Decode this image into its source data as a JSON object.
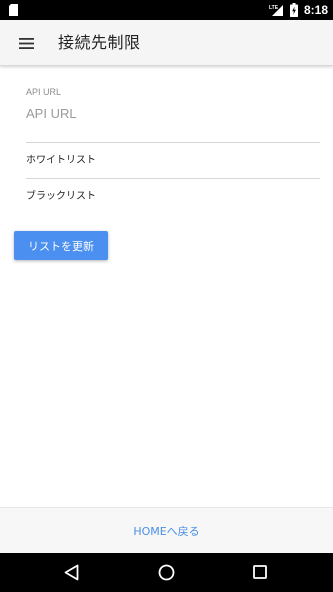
{
  "status_bar": {
    "time": "8:18",
    "network_label": "LTE",
    "icons": [
      "sim-card-icon",
      "signal-icon",
      "battery-charging-icon"
    ]
  },
  "app_bar": {
    "title": "接続先制限",
    "menu_icon": "hamburger-menu-icon"
  },
  "form": {
    "api_url_label": "API URL",
    "api_url_placeholder": "API URL",
    "api_url_value": ""
  },
  "lists": {
    "whitelist_label": "ホワイトリスト",
    "blacklist_label": "ブラックリスト"
  },
  "actions": {
    "refresh_label": "リストを更新"
  },
  "footer": {
    "home_label": "HOMEへ戻る"
  },
  "nav_bar": {
    "icons": [
      "back-icon",
      "home-icon",
      "recents-icon"
    ]
  },
  "colors": {
    "accent": "#4b8ff0",
    "link": "#4a8ee8",
    "app_bar_bg": "#f5f5f5"
  }
}
